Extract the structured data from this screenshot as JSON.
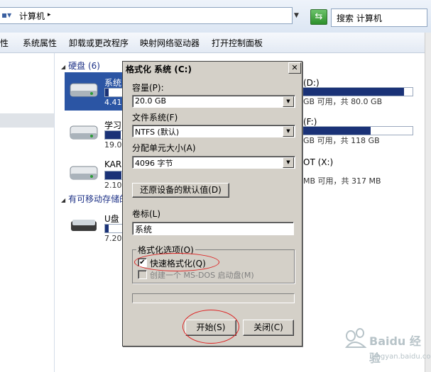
{
  "address_bar": {
    "path_label": "计算机",
    "search_placeholder": "搜索 计算机"
  },
  "command_bar": {
    "items": [
      "性",
      "系统属性",
      "卸载或更改程序",
      "映射网络驱动器",
      "打开控制面板"
    ]
  },
  "groups": {
    "hard_disks": "硬盘 (6)",
    "removable": "有可移动存储的"
  },
  "drives_left": [
    {
      "name": "系统",
      "size": "4.41",
      "fill": 0.2
    },
    {
      "name": "学习",
      "size": "19.0",
      "fill": 0.9
    },
    {
      "name": "KARL",
      "size": "2.10",
      "fill": 0.95
    },
    {
      "name": "U盘",
      "size": "7.20",
      "fill": 0.2
    }
  ],
  "drives_right": [
    {
      "letter": "(D:)",
      "info": "GB 可用，共 80.0 GB",
      "fill": 0.92
    },
    {
      "letter": "(F:)",
      "info": "GB 可用，共 118 GB",
      "fill": 0.62
    },
    {
      "letter": "OT (X:)",
      "info": "MB 可用，共 317 MB",
      "fill": 0.0
    }
  ],
  "dialog": {
    "title": "格式化 系统 (C:)",
    "close": "✕",
    "capacity_label": "容量(P):",
    "capacity_value": "20.0 GB",
    "filesystem_label": "文件系统(F)",
    "filesystem_value": "NTFS (默认)",
    "allocation_label": "分配单元大小(A)",
    "allocation_value": "4096 字节",
    "restore_defaults": "还原设备的默认值(D)",
    "volume_label": "卷标(L)",
    "volume_value": "系统",
    "format_options": "格式化选项(O)",
    "quick_format": "快速格式化(Q)",
    "msdos_disk": "创建一个 MS-DOS 启动盘(M)",
    "start": "开始(S)",
    "close_button": "关闭(C)"
  },
  "watermark": {
    "text": "Baidu 经验",
    "url": "jingyan.baidu.com"
  },
  "colors": {
    "accent": "#1a3277",
    "highlight": "#d22222",
    "dialog_bg": "#d4d0c8"
  }
}
